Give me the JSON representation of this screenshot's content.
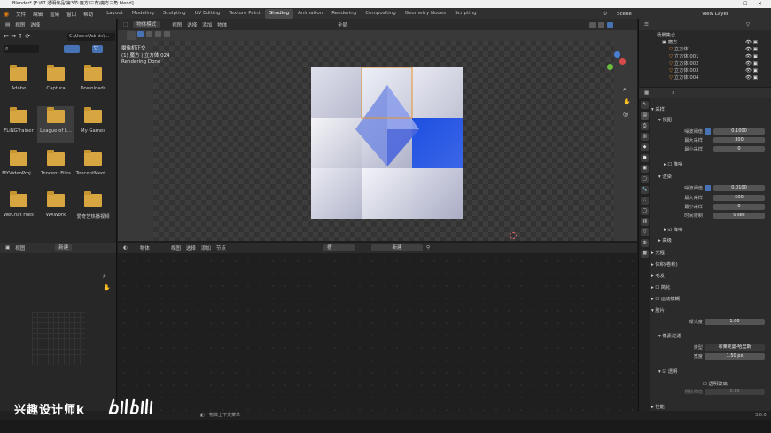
{
  "window": {
    "title": "Blender* [F:\\67 透明作品\\第3节:魔方\\三角\\魔方三角.blend]"
  },
  "topbar": {
    "menus": [
      "文件",
      "编辑",
      "渲染",
      "窗口",
      "帮助"
    ],
    "workspaces": [
      "Layout",
      "Modeling",
      "Sculpting",
      "UV Editing",
      "Texture Paint",
      "Shading",
      "Animation",
      "Rendering",
      "Compositing",
      "Geometry Nodes",
      "Scripting"
    ],
    "scene_label": "Scene",
    "viewlayer_label": "View Layer"
  },
  "filebrowser": {
    "header_menus": [
      "视图",
      "选择"
    ],
    "path": "C:\\Users\\Admin\\...",
    "folders": [
      "Adobe",
      "Captura",
      "Downloads",
      "FLiNGTrainer",
      "League of L...",
      "My Games",
      "MYVideoProj...",
      "Tencent Files",
      "TencentMeet...",
      "WeChat Files",
      "WXWork",
      "爱奇艺热播视频"
    ]
  },
  "viewport": {
    "mode_label": "物体模式",
    "menus": [
      "视图",
      "选择",
      "添加",
      "物体"
    ],
    "transform_label": "全局",
    "shading_label": "选项",
    "info_line1": "摄像机正交",
    "info_line2": "(1) 魔方 | 立方体.024",
    "info_line3": "Rendering Done"
  },
  "imgeditor": {
    "view_label": "视图",
    "new_label": "新建"
  },
  "nodeeditor": {
    "object_label": "物体",
    "menus": [
      "视图",
      "选择",
      "添加",
      "节点"
    ],
    "slot_label": "槽",
    "new_label": "新建"
  },
  "outliner": {
    "collection_root": "场景集合",
    "collection": "魔方",
    "items": [
      "立方体",
      "立方体.001",
      "立方体.002",
      "立方体.003",
      "立方体.004"
    ]
  },
  "properties": {
    "sampling_title": "采样",
    "viewport_title": "视图",
    "noise_threshold_label": "噪波阈值",
    "viewport_threshold": "0.1000",
    "max_samples_label": "最大采样",
    "viewport_max_samples": "300",
    "min_samples_label": "最小采样",
    "viewport_min_samples": "0",
    "denoise_label": "降噪",
    "render_title": "渲染",
    "render_threshold": "0.0100",
    "render_max_samples": "500",
    "render_min_samples": "0",
    "time_limit_label": "时间限制",
    "render_time_limit": "0 sec",
    "render_denoise_label": "降噪",
    "advanced_label": "高级",
    "lightpaths_label": "光程",
    "volumes_label": "体积(卷积)",
    "hair_label": "毛发",
    "simplify_label": "简化",
    "motionblur_label": "运动模糊",
    "film_title": "胶片",
    "exposure_label": "曝光度",
    "exposure_value": "1.00",
    "pixel_filter_title": "像素过滤",
    "filter_type_label": "类型",
    "filter_type_value": "布莱克曼-哈里斯",
    "width_label": "宽度",
    "width_value": "1.50 px",
    "transparent_label": "透明",
    "transparent_glass_label": "透明玻璃",
    "roughness_label": "粗糙阈值",
    "roughness_value": "0.10",
    "performance_label": "性能"
  },
  "statusbar": {
    "left_text": "物体上下文菜单",
    "version": "3.0.0"
  },
  "watermark": {
    "text": "兴趣设计师k"
  },
  "colors": {
    "accent_blue": "#4772b3",
    "folder": "#d8a640",
    "cube_blue": "#1d4fe0"
  }
}
